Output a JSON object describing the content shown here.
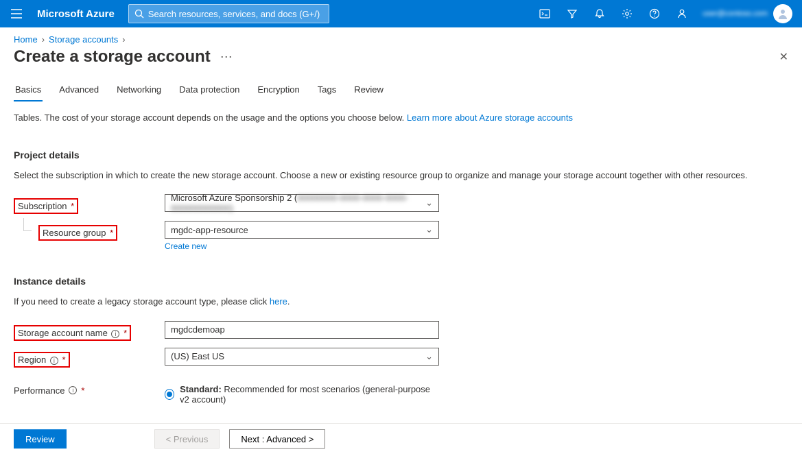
{
  "header": {
    "brand": "Microsoft Azure",
    "search_placeholder": "Search resources, services, and docs (G+/)",
    "account_text": "user@contoso.com"
  },
  "breadcrumb": {
    "home": "Home",
    "storage": "Storage accounts"
  },
  "page": {
    "title": "Create a storage account"
  },
  "tabs": [
    "Basics",
    "Advanced",
    "Networking",
    "Data protection",
    "Encryption",
    "Tags",
    "Review"
  ],
  "intro": {
    "line": "Tables. The cost of your storage account depends on the usage and the options you choose below. ",
    "link": "Learn more about Azure storage accounts"
  },
  "project": {
    "heading": "Project details",
    "desc": "Select the subscription in which to create the new storage account. Choose a new or existing resource group to organize and manage your storage account together with other resources.",
    "subscription_label": "Subscription",
    "subscription_value_prefix": "Microsoft Azure Sponsorship 2 (",
    "subscription_value_blur": "00000000-0000-0000-0000-000000000000)",
    "resource_group_label": "Resource group",
    "resource_group_value": "mgdc-app-resource",
    "create_new": "Create new"
  },
  "instance": {
    "heading": "Instance details",
    "desc_prefix": "If you need to create a legacy storage account type, please click ",
    "desc_link": "here",
    "name_label": "Storage account name",
    "name_value": "mgdcdemoap",
    "region_label": "Region",
    "region_value": "(US) East US",
    "performance_label": "Performance",
    "performance_option_strong": "Standard:",
    "performance_option_rest": " Recommended for most scenarios (general-purpose v2 account)"
  },
  "footer": {
    "review": "Review",
    "previous": "< Previous",
    "next": "Next : Advanced >"
  }
}
